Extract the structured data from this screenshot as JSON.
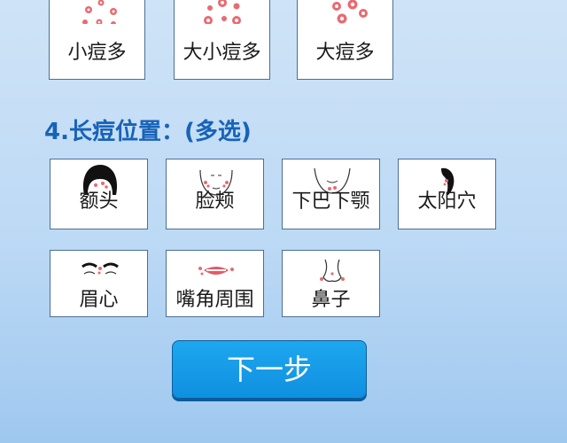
{
  "section3": {
    "options": [
      {
        "label": "小痘多"
      },
      {
        "label": "大小痘多"
      },
      {
        "label": "大痘多"
      }
    ]
  },
  "section4": {
    "title": "4.长痘位置：(多选)",
    "options": [
      {
        "label": "额头",
        "icon": "forehead-icon"
      },
      {
        "label": "脸颊",
        "icon": "cheek-icon"
      },
      {
        "label": "下巴下颚",
        "icon": "chin-icon"
      },
      {
        "label": "太阳穴",
        "icon": "temple-icon"
      },
      {
        "label": "眉心",
        "icon": "brow-icon"
      },
      {
        "label": "嘴角周围",
        "icon": "mouth-icon"
      },
      {
        "label": "鼻子",
        "icon": "nose-icon"
      }
    ]
  },
  "next_button": {
    "label": "下一步"
  },
  "colors": {
    "accent": "#1763b8",
    "button": "#1a9fea",
    "acne": "#e0505a"
  }
}
